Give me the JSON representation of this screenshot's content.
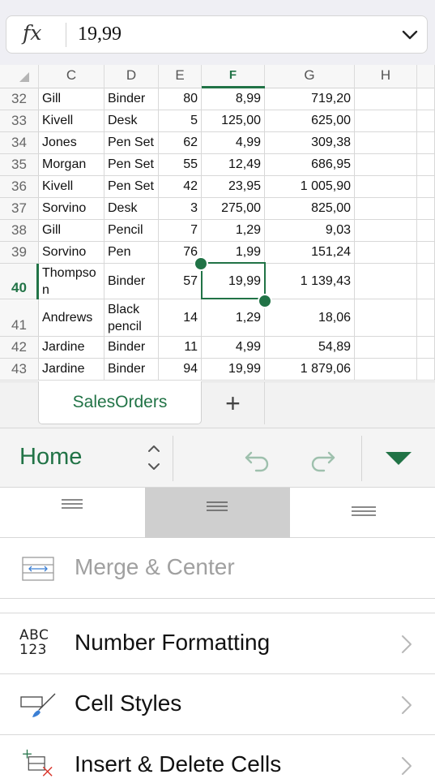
{
  "formula_bar": {
    "fx_label": "fx",
    "value": "19,99"
  },
  "columns": [
    {
      "label": "",
      "name": "corner"
    },
    {
      "label": "C"
    },
    {
      "label": "D"
    },
    {
      "label": "E"
    },
    {
      "label": "F",
      "active": true
    },
    {
      "label": "G"
    },
    {
      "label": "H"
    },
    {
      "label": ""
    }
  ],
  "rows": [
    {
      "num": "32",
      "c": "Gill",
      "d": "Binder",
      "e": "80",
      "f": "8,99",
      "g": "719,20"
    },
    {
      "num": "33",
      "c": "Kivell",
      "d": "Desk",
      "e": "5",
      "f": "125,00",
      "g": "625,00"
    },
    {
      "num": "34",
      "c": "Jones",
      "d": "Pen Set",
      "e": "62",
      "f": "4,99",
      "g": "309,38"
    },
    {
      "num": "35",
      "c": "Morgan",
      "d": "Pen Set",
      "e": "55",
      "f": "12,49",
      "g": "686,95"
    },
    {
      "num": "36",
      "c": "Kivell",
      "d": "Pen Set",
      "e": "42",
      "f": "23,95",
      "g": "1 005,90"
    },
    {
      "num": "37",
      "c": "Sorvino",
      "d": "Desk",
      "e": "3",
      "f": "275,00",
      "g": "825,00"
    },
    {
      "num": "38",
      "c": "Gill",
      "d": "Pencil",
      "e": "7",
      "f": "1,29",
      "g": "9,03"
    },
    {
      "num": "39",
      "c": "Sorvino",
      "d": "Pen",
      "e": "76",
      "f": "1,99",
      "g": "151,24"
    },
    {
      "num": "40",
      "c": "Thompson",
      "d": "Binder",
      "e": "57",
      "f": "19,99",
      "g": "1 139,43",
      "active": true
    },
    {
      "num": "41",
      "c": "Andrews",
      "d": "Black pencil",
      "e": "14",
      "f": "1,29",
      "g": "18,06"
    },
    {
      "num": "42",
      "c": "Jardine",
      "d": "Binder",
      "e": "11",
      "f": "4,99",
      "g": "54,89"
    },
    {
      "num": "43",
      "c": "Jardine",
      "d": "Binder",
      "e": "94",
      "f": "19,99",
      "g": "1 879,06"
    }
  ],
  "sheet_tabs": {
    "active": "SalesOrders",
    "add_label": "+"
  },
  "ribbon": {
    "tab": "Home"
  },
  "menu": {
    "merge_center": "Merge & Center",
    "number_formatting": "Number Formatting",
    "number_icon_top": "ABC",
    "number_icon_bottom": "123",
    "cell_styles": "Cell Styles",
    "insert_delete": "Insert & Delete Cells"
  },
  "colors": {
    "accent": "#217346",
    "brush": "#3b7fd4",
    "delete_x": "#d9352b"
  }
}
